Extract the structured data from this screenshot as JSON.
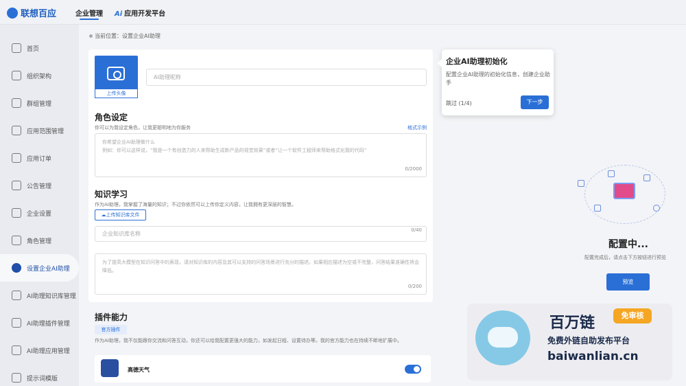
{
  "app": {
    "brand": "联想百应"
  },
  "top_nav": [
    {
      "label": "企业管理",
      "active": true
    },
    {
      "label": "应用开发平台",
      "badge": "Ai"
    }
  ],
  "sidebar": {
    "items": [
      {
        "label": "首页",
        "icon": "home-icon"
      },
      {
        "label": "组织架构",
        "icon": "layers-icon"
      },
      {
        "label": "群组管理",
        "icon": "group-icon"
      },
      {
        "label": "应用范围管理",
        "icon": "monitor-icon"
      },
      {
        "label": "应用订单",
        "icon": "document-icon"
      },
      {
        "label": "公告管理",
        "icon": "bell-icon"
      },
      {
        "label": "企业设置",
        "icon": "settings-doc-icon"
      },
      {
        "label": "角色管理",
        "icon": "user-icon"
      },
      {
        "label": "设置企业AI助理",
        "icon": "ai-assistant-icon",
        "active": true
      },
      {
        "label": "AI助理知识库管理",
        "icon": "library-icon"
      },
      {
        "label": "AI助理插件管理",
        "icon": "plugin-icon"
      },
      {
        "label": "AI助理应用管理",
        "icon": "ai-app-icon"
      },
      {
        "label": "提示词模版",
        "icon": "template-icon"
      }
    ]
  },
  "breadcrumb": "当前位置：设置企业AI助理",
  "form": {
    "upload_avatar": "上传头像",
    "name_placeholder": "AI助理昵称",
    "role": {
      "title": "角色设定",
      "hint": "你可以为我设定角色，让我更聪明地为你服务",
      "format_link": "格式示例",
      "placeholder_line1": "你希望企业AI助理做什么",
      "placeholder_line2": "例如：你可以这样说，“我是一个有创造力的人来帮助生成新产品的视觉效果”或者“让一个软件工程师来帮助格式化我的代码”",
      "counter": "0/2000"
    },
    "knowledge": {
      "title": "知识学习",
      "hint": "作为AI助理，我掌握了海量的知识；不过你依然可以上传你定义内容，让我拥有更深层的智慧。",
      "upload_button": "上传知识库文件",
      "kb_name_placeholder": "企业知识库名称",
      "kb_name_counter": "0/40",
      "desc_placeholder": "为了提高大模型在知识问答中的表现，请对知识库的内容及其可以支持的问答场景进行充分的描述。如果相应描述为空或不完整，问答结果准确性将会降低。",
      "desc_counter": "0/200"
    },
    "plugins": {
      "title": "插件能力",
      "tag": "官方插件",
      "hint": "作为AI助理，我不仅能跟你交流和问答互动，你还可以给我配置更强大的能力，如发起日程、设置待办等。我的官方能力也在持续不断地扩展中。",
      "items": [
        {
          "name": "高德天气",
          "enabled": true
        }
      ]
    }
  },
  "tour": {
    "title": "企业AI助理初始化",
    "description": "配置企业AI助理的初始化信息，创建企业助手",
    "skip": "跳过 (1/4)",
    "next": "下一步"
  },
  "config_panel": {
    "title": "配置中...",
    "description": "配置完成后，请点击下方按钮进行预览",
    "preview_button": "预览"
  },
  "watermark": {
    "title": "百万链",
    "badge": "免审核",
    "subtitle": "免费外链自助发布平台",
    "url": "baiwanlian.cn"
  },
  "colors": {
    "accent": "#2a6fd6",
    "sidebar_bg": "#e9ebf0",
    "page_bg": "#f3f4f7",
    "badge_orange": "#f5a623"
  }
}
